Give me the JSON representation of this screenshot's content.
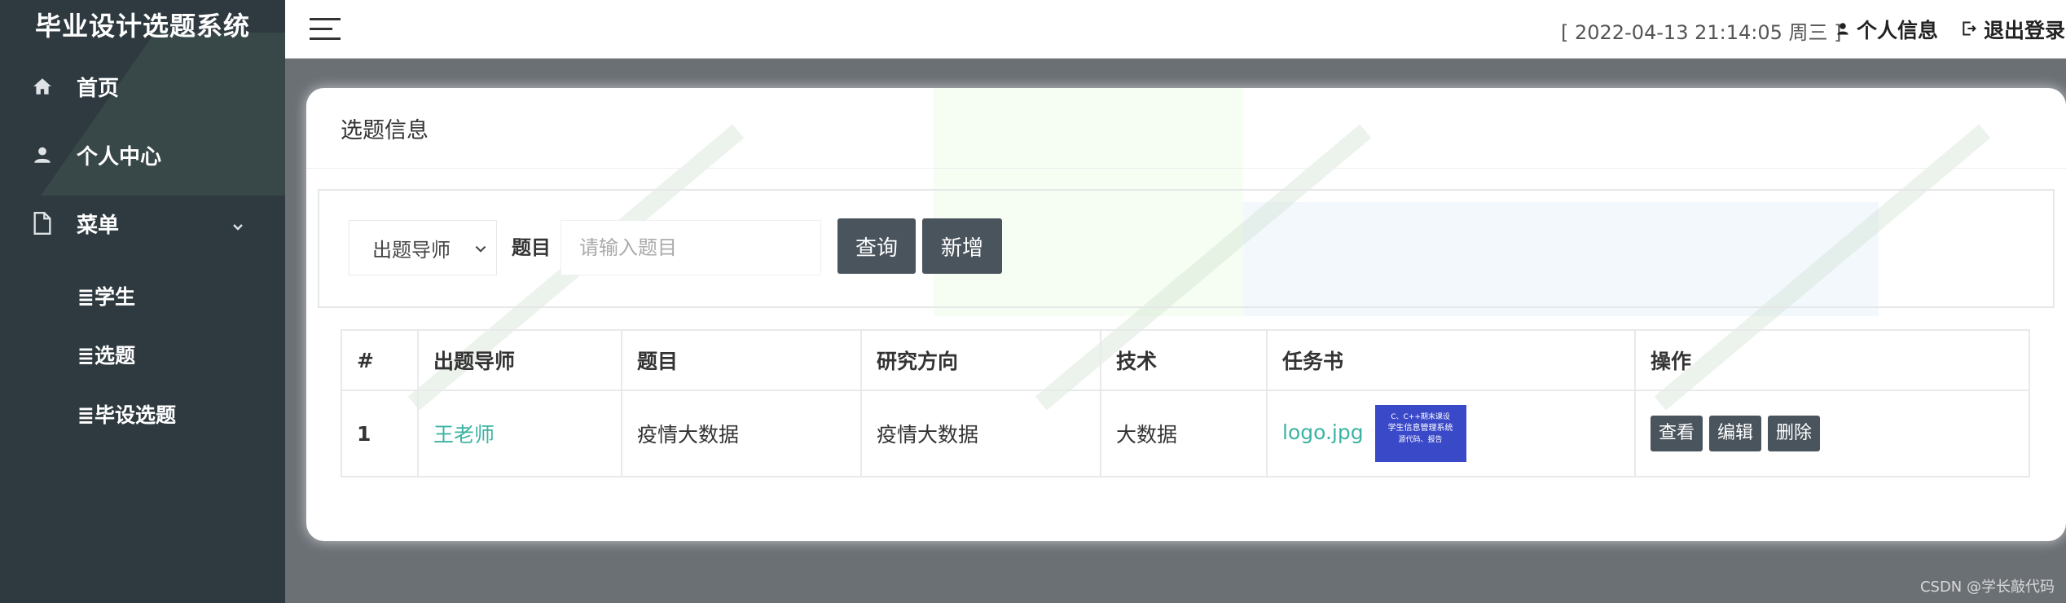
{
  "sidebar": {
    "brand": "毕业设计选题系统",
    "items": [
      {
        "label": "首页",
        "icon": "home-icon"
      },
      {
        "label": "个人中心",
        "icon": "person-icon"
      },
      {
        "label": "菜单",
        "icon": "file-icon"
      }
    ],
    "sub_items": [
      {
        "label": "≣学生"
      },
      {
        "label": "≣选题"
      },
      {
        "label": "≣毕设选题"
      }
    ]
  },
  "topbar": {
    "datetime": "[ 2022-04-13 21:14:05 周三 ]",
    "user_info": "个人信息",
    "logout": "退出登录"
  },
  "card": {
    "title": "选题信息"
  },
  "search": {
    "select_value": "出题导师",
    "label": "题目",
    "placeholder": "请输入题目",
    "query_button": "查询",
    "add_button": "新增"
  },
  "table": {
    "headers": [
      "#",
      "出题导师",
      "题目",
      "研究方向",
      "技术",
      "任务书",
      "操作"
    ],
    "rows": [
      {
        "index": "1",
        "teacher": "王老师",
        "topic": "疫情大数据",
        "direction": "疫情大数据",
        "tech": "大数据",
        "file_name": "logo.jpg",
        "thumb_line1": "C、C++期末课设",
        "thumb_line2": "学生信息管理系统",
        "thumb_line3": "源代码、报告",
        "actions": [
          "查看",
          "编辑",
          "删除"
        ]
      }
    ]
  },
  "watermark": "CSDN @学长敲代码",
  "colors": {
    "sidebar_bg": "#2f3a40",
    "button_dark": "#4a545d",
    "link": "#3bb3a3"
  }
}
